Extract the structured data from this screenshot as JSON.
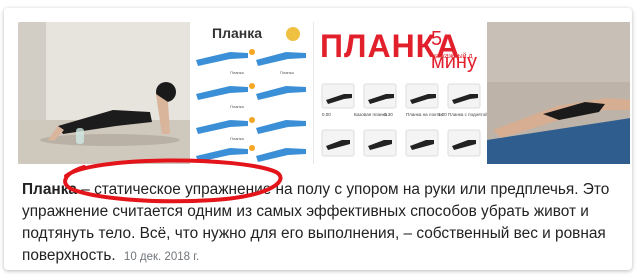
{
  "images": [
    {
      "name": "planka-photo-woman"
    },
    {
      "name": "planka-infographic",
      "title": "Планка",
      "labels": [
        "Планка",
        "Планка",
        "Планка",
        "Планка",
        "Планка"
      ]
    },
    {
      "name": "planka-5-min-poster",
      "title": "ПЛАНКА",
      "subtitle": "5 мину",
      "caption": "на каждый д",
      "labels": [
        "0.00",
        "Базовая планка",
        "0.30",
        "Планка на локтях",
        "1.00",
        "Планка с поднятой р"
      ]
    },
    {
      "name": "planka-photo-mat"
    }
  ],
  "snippet": {
    "term": "Планка",
    "text": " – статическое упражнение на полу с упором на руки или предплечья. Это упражнение считается одним из самых эффективных способов убрать живот и подтянуть тело. Всё, что нужно для его выполнения, – собственный вес и ровная поверхность.",
    "date": "10 дек. 2018 г."
  },
  "colors": {
    "annotation": "#e4141b",
    "poster_red": "#e2202c",
    "date_gray": "#70757a"
  }
}
